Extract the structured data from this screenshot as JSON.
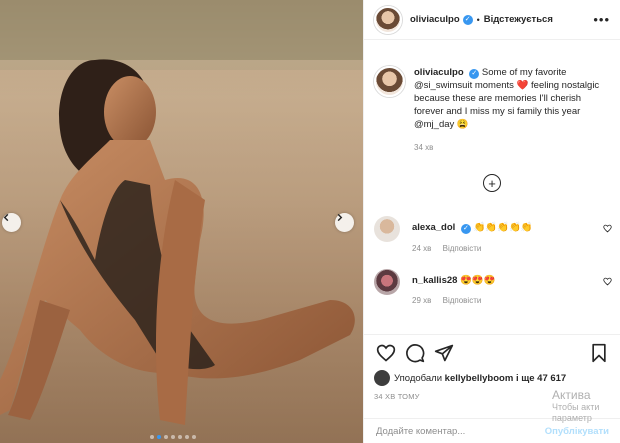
{
  "header": {
    "username": "oliviaculpo",
    "separator": "•",
    "follow_label": "Відстежується",
    "more_icon": "more-horizontal-icon"
  },
  "caption": {
    "username": "oliviaculpo",
    "text_1": "Some of my favorite @si_swimsuit moments",
    "text_2": "feeling nostalgic because these are memories I'll cherish forever and I miss my si family this year @mj_day",
    "emoji_heart": "❤️",
    "emoji_end": "😩",
    "time": "34 хв"
  },
  "comments": [
    {
      "username": "alexa_dol",
      "text": "👏👏👏👏👏",
      "time": "24 хв",
      "reply_label": "Відповісти"
    },
    {
      "username": "n_kallis28",
      "text": "😍😍😍",
      "time": "29 хв",
      "reply_label": "Відповісти"
    }
  ],
  "likes": {
    "prefix": "Уподобали",
    "user": "kellybellyboom",
    "suffix": "і ще 47 617"
  },
  "posted": "34 ХВ ТОМУ",
  "add_comment": {
    "placeholder": "Додайте коментар...",
    "publish_label": "Опублікувати"
  },
  "watermark": {
    "line1": "Актива",
    "line2": "Чтобы акти",
    "line3": "параметр"
  },
  "colors": {
    "verified": "#3897f0",
    "heart": "#ed4956",
    "publish_disabled": "#b2dffc"
  }
}
